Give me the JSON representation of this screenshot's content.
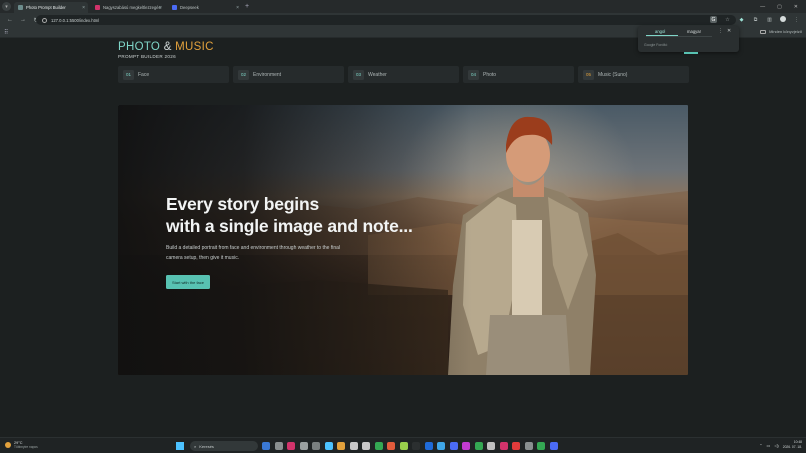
{
  "browser": {
    "tabs": [
      {
        "title": "Photo Prompt Builder",
        "favicon_color": "#6c8c8c",
        "active": true
      },
      {
        "title": "Nagyszabású megkeltlezzegés",
        "favicon_color": "#d2336b",
        "active": false
      },
      {
        "title": "Deepseek",
        "favicon_color": "#4b6bf5",
        "active": false
      }
    ],
    "new_tab": "+",
    "url": "127.0.0.1:5500/index.html",
    "all_bookmarks": "Minden könyvjelző"
  },
  "translate_popup": {
    "source_lang": "angol",
    "target_lang": "magyar",
    "footer": "Google Fordító"
  },
  "header": {
    "title_photo": "PHOTO",
    "title_amp": "&",
    "title_music": "MUSIC",
    "subtitle": "PROMPT BUILDER 2026"
  },
  "steps": [
    {
      "num": "01",
      "label": "Face"
    },
    {
      "num": "02",
      "label": "Environment"
    },
    {
      "num": "03",
      "label": "Weather"
    },
    {
      "num": "04",
      "label": "Photo"
    },
    {
      "num": "05",
      "label": "Music (Suno)"
    }
  ],
  "hero": {
    "title_line1": "Every story begins",
    "title_line2": "with a single image and note...",
    "text": "Build a detailed portrait from face and environment through weather to the final camera setup, then give it music.",
    "cta": "Start with the face"
  },
  "taskbar": {
    "temp": "29°C",
    "weather": "Többnyire napos",
    "search": "Keresés",
    "time": "10:48",
    "date": "2026. 07. 18.",
    "app_colors": [
      "#3a78d4",
      "#8a8f90",
      "#d2336b",
      "#9aa0a0",
      "#7a8080",
      "#4cc2ff",
      "#e2a13c",
      "#c8c8c8",
      "#c8c8c8",
      "#34a853",
      "#e25c3c",
      "#9ad04c",
      "#2b2f30",
      "#1f6ad8",
      "#3fa6e8",
      "#4b6bf5",
      "#c23bd0",
      "#34a853",
      "#c0c0c0",
      "#d2336b",
      "#e23b3b",
      "#8a8f90",
      "#34a853",
      "#4b6bf5"
    ]
  },
  "colors": {
    "accent_teal": "#7fd6c8",
    "accent_orange": "#e2a13c",
    "cta": "#58c2b2"
  }
}
